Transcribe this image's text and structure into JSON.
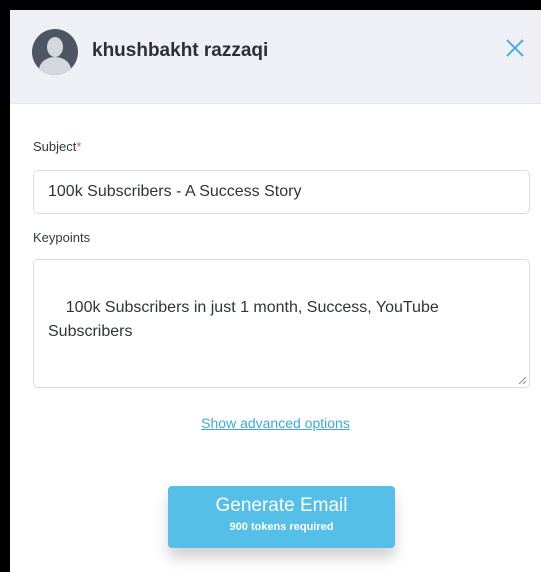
{
  "header": {
    "user_name": "khushbakht razzaqi"
  },
  "form": {
    "subject_label": "Subject",
    "subject_required_mark": "*",
    "subject_value": "100k Subscribers - A Success Story",
    "keypoints_label": "Keypoints",
    "keypoints_value": "100k Subscribers in just 1 month, Success, YouTube Subscribers"
  },
  "advanced_options_label": "Show advanced options",
  "generate_button": {
    "label": "Generate Email",
    "sublabel": "900 tokens required"
  },
  "icons": {
    "avatar": "user-avatar-icon",
    "close": "close-icon",
    "resize": "resize-grip-icon"
  },
  "colors": {
    "accent": "#55bfe8",
    "link": "#3fa8d8",
    "header_bg": "#eef0f6",
    "required": "#e05a5a"
  }
}
